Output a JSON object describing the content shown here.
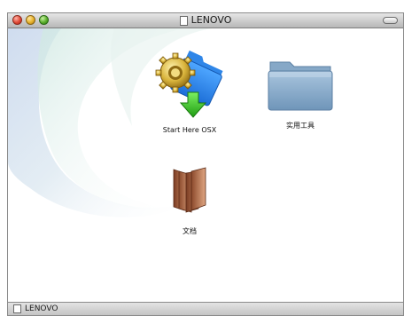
{
  "window": {
    "title": "LENOVO"
  },
  "icons": {
    "start_here": {
      "label": "Start Here OSX",
      "icon": "installer-folder-icon"
    },
    "utilities": {
      "label": "实用工具",
      "icon": "folder-icon"
    },
    "documents": {
      "label": "文档",
      "icon": "books-icon"
    }
  },
  "statusbar": {
    "path_label": "LENOVO"
  },
  "colors": {
    "folder_blue": "#8fb2d0",
    "arrow_green": "#35c424",
    "gear_gold": "#d9b43c",
    "books_brown": "#b8714c"
  }
}
